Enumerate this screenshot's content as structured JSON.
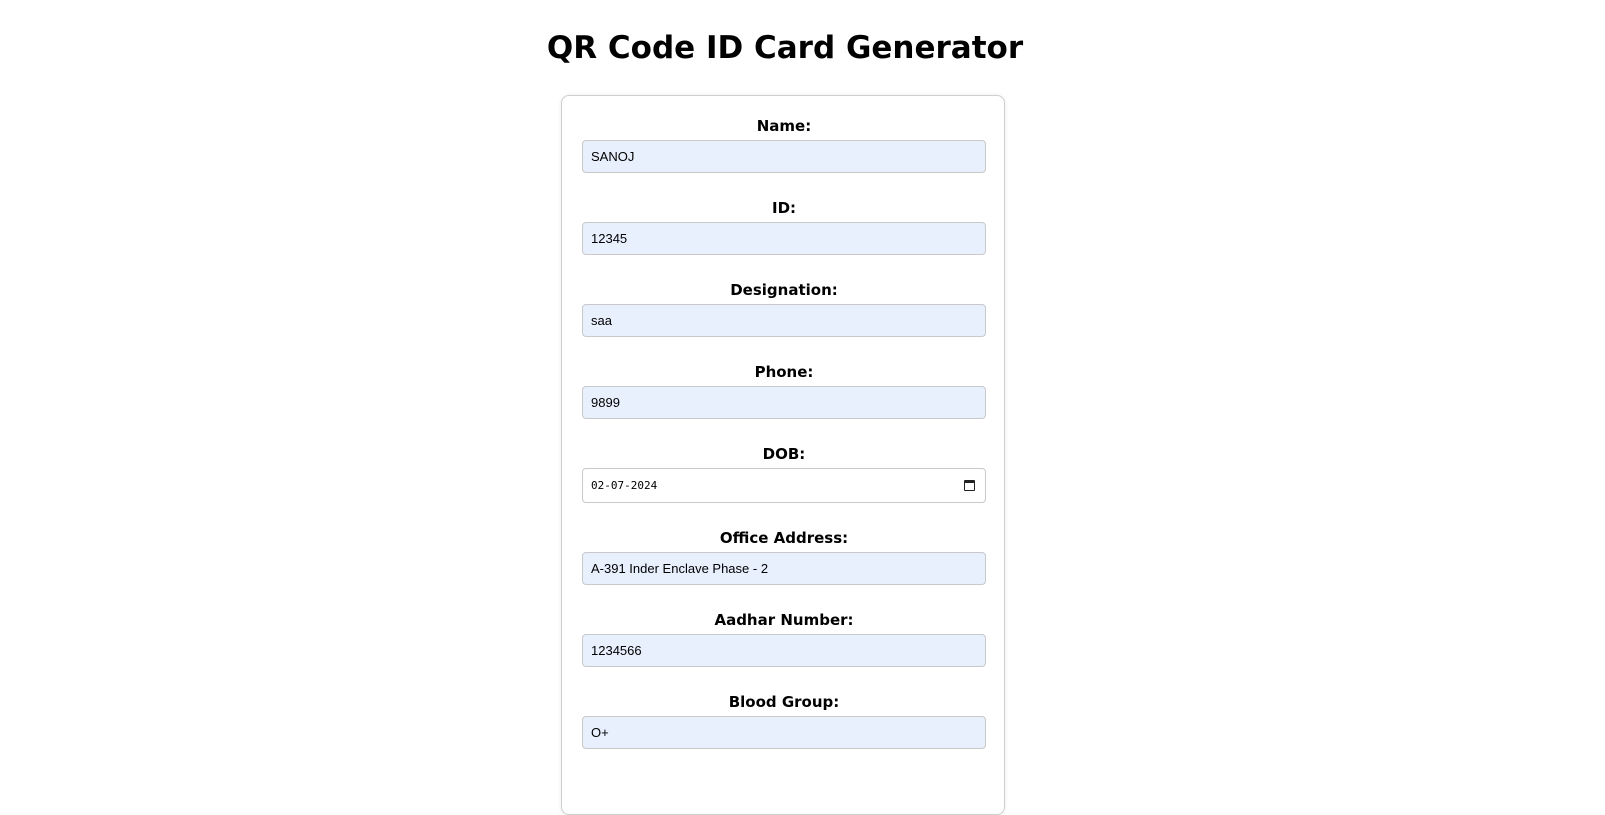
{
  "page": {
    "title": "QR Code ID Card Generator"
  },
  "form": {
    "fields": [
      {
        "label": "Name:",
        "value": "SANOJ"
      },
      {
        "label": "ID:",
        "value": "12345"
      },
      {
        "label": "Designation:",
        "value": "saa"
      },
      {
        "label": "Phone:",
        "value": "9899"
      },
      {
        "label": "DOB:",
        "value": "02-07-2024"
      },
      {
        "label": "Office Address:",
        "value": "A-391 Inder Enclave Phase - 2"
      },
      {
        "label": "Aadhar Number:",
        "value": "1234566"
      },
      {
        "label": "Blood Group:",
        "value": "O+"
      }
    ]
  },
  "icons": {
    "dob_picker": "calendar-icon"
  },
  "colors": {
    "autofill_background": "#e8f0fe",
    "border": "#c9c9c9"
  }
}
